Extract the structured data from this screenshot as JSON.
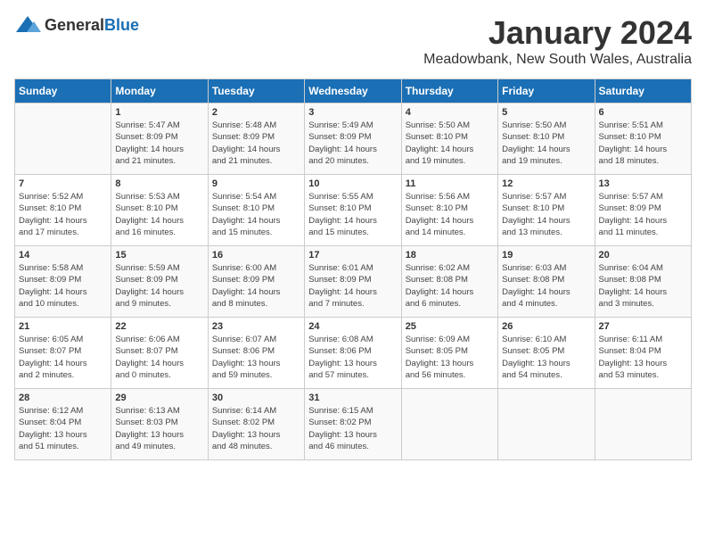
{
  "logo": {
    "general": "General",
    "blue": "Blue"
  },
  "title": "January 2024",
  "subtitle": "Meadowbank, New South Wales, Australia",
  "headers": [
    "Sunday",
    "Monday",
    "Tuesday",
    "Wednesday",
    "Thursday",
    "Friday",
    "Saturday"
  ],
  "weeks": [
    [
      {
        "day": "",
        "info": ""
      },
      {
        "day": "1",
        "info": "Sunrise: 5:47 AM\nSunset: 8:09 PM\nDaylight: 14 hours\nand 21 minutes."
      },
      {
        "day": "2",
        "info": "Sunrise: 5:48 AM\nSunset: 8:09 PM\nDaylight: 14 hours\nand 21 minutes."
      },
      {
        "day": "3",
        "info": "Sunrise: 5:49 AM\nSunset: 8:09 PM\nDaylight: 14 hours\nand 20 minutes."
      },
      {
        "day": "4",
        "info": "Sunrise: 5:50 AM\nSunset: 8:10 PM\nDaylight: 14 hours\nand 19 minutes."
      },
      {
        "day": "5",
        "info": "Sunrise: 5:50 AM\nSunset: 8:10 PM\nDaylight: 14 hours\nand 19 minutes."
      },
      {
        "day": "6",
        "info": "Sunrise: 5:51 AM\nSunset: 8:10 PM\nDaylight: 14 hours\nand 18 minutes."
      }
    ],
    [
      {
        "day": "7",
        "info": "Sunrise: 5:52 AM\nSunset: 8:10 PM\nDaylight: 14 hours\nand 17 minutes."
      },
      {
        "day": "8",
        "info": "Sunrise: 5:53 AM\nSunset: 8:10 PM\nDaylight: 14 hours\nand 16 minutes."
      },
      {
        "day": "9",
        "info": "Sunrise: 5:54 AM\nSunset: 8:10 PM\nDaylight: 14 hours\nand 15 minutes."
      },
      {
        "day": "10",
        "info": "Sunrise: 5:55 AM\nSunset: 8:10 PM\nDaylight: 14 hours\nand 15 minutes."
      },
      {
        "day": "11",
        "info": "Sunrise: 5:56 AM\nSunset: 8:10 PM\nDaylight: 14 hours\nand 14 minutes."
      },
      {
        "day": "12",
        "info": "Sunrise: 5:57 AM\nSunset: 8:10 PM\nDaylight: 14 hours\nand 13 minutes."
      },
      {
        "day": "13",
        "info": "Sunrise: 5:57 AM\nSunset: 8:09 PM\nDaylight: 14 hours\nand 11 minutes."
      }
    ],
    [
      {
        "day": "14",
        "info": "Sunrise: 5:58 AM\nSunset: 8:09 PM\nDaylight: 14 hours\nand 10 minutes."
      },
      {
        "day": "15",
        "info": "Sunrise: 5:59 AM\nSunset: 8:09 PM\nDaylight: 14 hours\nand 9 minutes."
      },
      {
        "day": "16",
        "info": "Sunrise: 6:00 AM\nSunset: 8:09 PM\nDaylight: 14 hours\nand 8 minutes."
      },
      {
        "day": "17",
        "info": "Sunrise: 6:01 AM\nSunset: 8:09 PM\nDaylight: 14 hours\nand 7 minutes."
      },
      {
        "day": "18",
        "info": "Sunrise: 6:02 AM\nSunset: 8:08 PM\nDaylight: 14 hours\nand 6 minutes."
      },
      {
        "day": "19",
        "info": "Sunrise: 6:03 AM\nSunset: 8:08 PM\nDaylight: 14 hours\nand 4 minutes."
      },
      {
        "day": "20",
        "info": "Sunrise: 6:04 AM\nSunset: 8:08 PM\nDaylight: 14 hours\nand 3 minutes."
      }
    ],
    [
      {
        "day": "21",
        "info": "Sunrise: 6:05 AM\nSunset: 8:07 PM\nDaylight: 14 hours\nand 2 minutes."
      },
      {
        "day": "22",
        "info": "Sunrise: 6:06 AM\nSunset: 8:07 PM\nDaylight: 14 hours\nand 0 minutes."
      },
      {
        "day": "23",
        "info": "Sunrise: 6:07 AM\nSunset: 8:06 PM\nDaylight: 13 hours\nand 59 minutes."
      },
      {
        "day": "24",
        "info": "Sunrise: 6:08 AM\nSunset: 8:06 PM\nDaylight: 13 hours\nand 57 minutes."
      },
      {
        "day": "25",
        "info": "Sunrise: 6:09 AM\nSunset: 8:05 PM\nDaylight: 13 hours\nand 56 minutes."
      },
      {
        "day": "26",
        "info": "Sunrise: 6:10 AM\nSunset: 8:05 PM\nDaylight: 13 hours\nand 54 minutes."
      },
      {
        "day": "27",
        "info": "Sunrise: 6:11 AM\nSunset: 8:04 PM\nDaylight: 13 hours\nand 53 minutes."
      }
    ],
    [
      {
        "day": "28",
        "info": "Sunrise: 6:12 AM\nSunset: 8:04 PM\nDaylight: 13 hours\nand 51 minutes."
      },
      {
        "day": "29",
        "info": "Sunrise: 6:13 AM\nSunset: 8:03 PM\nDaylight: 13 hours\nand 49 minutes."
      },
      {
        "day": "30",
        "info": "Sunrise: 6:14 AM\nSunset: 8:02 PM\nDaylight: 13 hours\nand 48 minutes."
      },
      {
        "day": "31",
        "info": "Sunrise: 6:15 AM\nSunset: 8:02 PM\nDaylight: 13 hours\nand 46 minutes."
      },
      {
        "day": "",
        "info": ""
      },
      {
        "day": "",
        "info": ""
      },
      {
        "day": "",
        "info": ""
      }
    ]
  ]
}
